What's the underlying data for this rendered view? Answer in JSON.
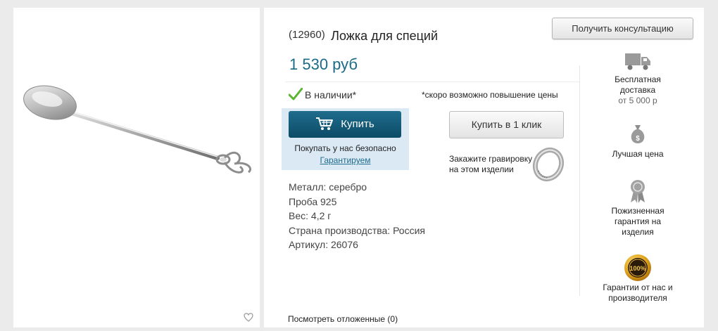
{
  "product": {
    "sku": "(12960)",
    "title": "Ложка для специй",
    "price": "1 530 руб",
    "stock": "В наличии*",
    "price_note": "*скоро возможно повышение цены",
    "specs": [
      "Металл: серебро",
      "Проба 925",
      "Вес: 4,2 г",
      "Страна производства: Россия",
      "Артикул: 26076"
    ]
  },
  "buttons": {
    "consult": "Получить консультацию",
    "buy": "Купить",
    "one_click": "Купить в 1 клик"
  },
  "buy_box": {
    "safe_text": "Покупать у нас безопасно",
    "guarantee_link": "Гарантируем"
  },
  "engraving": {
    "line1": "Закажите гравировку",
    "line2": "на этом изделии"
  },
  "features": {
    "delivery": {
      "line1": "Бесплатная",
      "line2": "доставка",
      "sub": "от 5 000 р",
      "icon": "truck-icon"
    },
    "price": {
      "line1": "Лучшая цена",
      "icon": "money-bag-icon"
    },
    "warranty": {
      "line1": "Пожизненная",
      "line2": "гарантия на",
      "line3": "изделия",
      "icon": "award-ribbon-icon"
    },
    "guarantee": {
      "line1": "Гарантии от нас и",
      "line2": "производителя",
      "badge": "100%",
      "icon": "gold-seal-icon"
    }
  },
  "footer": {
    "saved": "Посмотреть отложенные (0)"
  },
  "colors": {
    "accent": "#1b6a88",
    "buy_button": "#0f5673",
    "buy_box_bg": "#dbe9f5",
    "check": "#5cb531"
  }
}
